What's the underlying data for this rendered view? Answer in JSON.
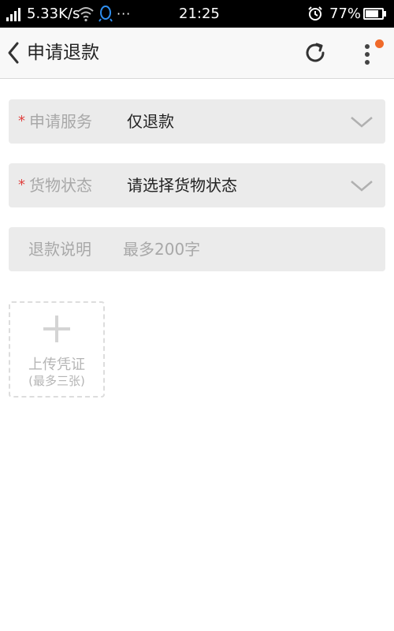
{
  "status_bar": {
    "network_speed": "5.33K/s",
    "more": "···",
    "time": "21:25",
    "battery": "77%"
  },
  "nav": {
    "title": "申请退款"
  },
  "form": {
    "service": {
      "required_mark": "*",
      "label": "申请服务",
      "value": "仅退款"
    },
    "goods_status": {
      "required_mark": "*",
      "label": "货物状态",
      "value": "请选择货物状态"
    },
    "description": {
      "label": "退款说明",
      "value": "",
      "placeholder": "最多200字"
    }
  },
  "upload": {
    "label": "上传凭证",
    "hint": "(最多三张)"
  },
  "colors": {
    "accent": "#f06a2a",
    "required": "#e0413f",
    "field_bg": "#ebebeb",
    "label_gray": "#a8a8a8",
    "qq_blue": "#2f8ff0"
  },
  "icons": {
    "back": "chevron-left-icon",
    "refresh": "refresh-icon",
    "menu": "more-vertical-icon",
    "dropdown": "chevron-down-icon",
    "upload": "plus-icon"
  }
}
